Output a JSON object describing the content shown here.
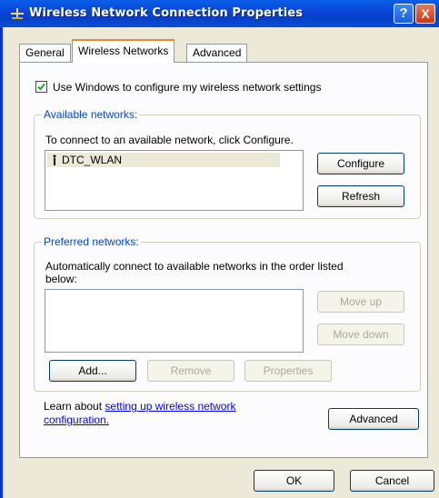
{
  "window": {
    "title": "Wireless Network Connection Properties",
    "help_glyph": "?",
    "close_glyph": "X"
  },
  "tabs": [
    {
      "label": "General"
    },
    {
      "label": "Wireless Networks"
    },
    {
      "label": "Advanced"
    }
  ],
  "use_windows": {
    "label": "Use Windows to configure my wireless network settings",
    "checked": true
  },
  "available": {
    "legend": "Available networks:",
    "instruction": "To connect to an available network, click Configure.",
    "networks": [
      {
        "name": "DTC_WLAN"
      }
    ],
    "configure_label": "Configure",
    "refresh_label": "Refresh"
  },
  "preferred": {
    "legend": "Preferred networks:",
    "instruction_line1": "Automatically connect to available networks in the order listed",
    "instruction_line2": "below:",
    "move_up_label": "Move up",
    "move_down_label": "Move down",
    "add_label": "Add...",
    "remove_label": "Remove",
    "properties_label": "Properties"
  },
  "learn": {
    "prefix": "Learn about ",
    "link_line1": "setting up wireless network",
    "link_line2": "configuration.",
    "advanced_label": "Advanced"
  },
  "footer": {
    "ok_label": "OK",
    "cancel_label": "Cancel"
  },
  "colors": {
    "title_bar": "#0846d8",
    "dialog_bg": "#ece9d8",
    "group_legend": "#0046d5",
    "active_tab_accent": "#e68b2c",
    "link": "#0000ff"
  },
  "icons": {
    "window": "wireless-network-icon",
    "network": "antenna-icon",
    "checkbox": "checkmark-icon"
  }
}
